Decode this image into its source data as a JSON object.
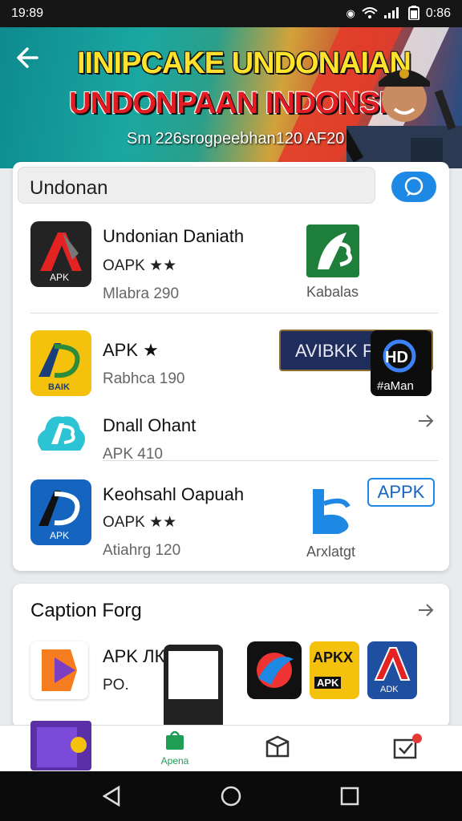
{
  "status": {
    "time": "19:89",
    "right_time": "0:86"
  },
  "hero": {
    "title_line1": "IINIPCAKE UNDONAIAN",
    "title_line2": "UNDONPAAN INDONSIIA",
    "subtitle": "Sm 226srogpeebhan120 AF20"
  },
  "search": {
    "value": "Undonan"
  },
  "apps": [
    {
      "name": "Undonian Daniath",
      "meta": "OAPK ★★",
      "sub": "Mlabra 290",
      "side_label": "Kabalas",
      "icon_label": "APK"
    },
    {
      "name": "APK ★",
      "sub": "Rabhca 190",
      "button_label": "AVIBKK P",
      "badge_label": "#aMan",
      "icon_label": "BAIK"
    },
    {
      "name": "Dnall Ohant",
      "sub": "APK 410"
    },
    {
      "name": "Keohsahl Oapuah",
      "meta": "OAPK ★★",
      "sub": "Atiahrg 120",
      "side_label": "Arxlatgt",
      "pill_label": "APPK",
      "icon_label": "APK"
    }
  ],
  "section2": {
    "title": "Caption Forg",
    "item": {
      "name": "APK ЛК",
      "sub": "PO."
    },
    "thumb_labels": [
      "APKX",
      "APK",
      "ADK"
    ]
  },
  "bottom_nav": {
    "active_label": "Apena"
  },
  "colors": {
    "accent_blue": "#1e88e5",
    "nav_green": "#1f9d55"
  }
}
